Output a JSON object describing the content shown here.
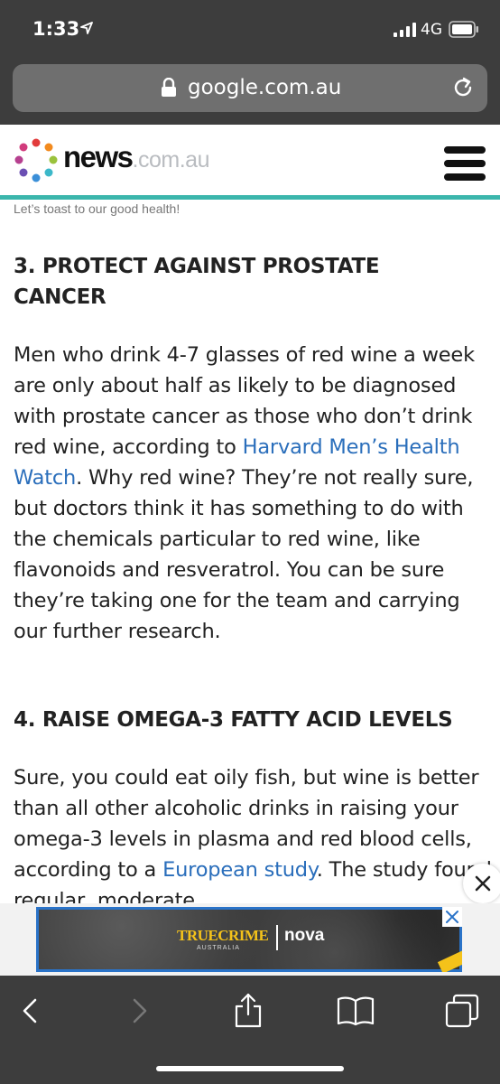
{
  "status_bar": {
    "time": "1:33",
    "network": "4G"
  },
  "browser": {
    "url": "google.com.au"
  },
  "site": {
    "logo_main": "news",
    "logo_suffix": ".com.au"
  },
  "article": {
    "caption": "Let’s toast to our good health!",
    "section1": {
      "heading_line1": "3. PROTECT AGAINST PROSTATE",
      "heading_line2": "CANCER",
      "p_part1": "Men who drink 4-7 glasses of red wine a week are only about half as likely to be diagnosed with prostate cancer as those who don’t drink red wine, according to ",
      "p_link": "Harvard Men’s Health Watch",
      "p_part2": ". Why red wine? They’re not really sure, but doctors think it has something to do with the chemicals particular to red wine, like flavonoids and resveratrol. You can be sure they’re taking one for the team and carrying our further research."
    },
    "section2": {
      "heading": "4. RAISE OMEGA-3 FATTY ACID LEVELS",
      "p_part1": "Sure, you could eat oily fish, but wine is better than all other alcoholic drinks in raising your omega-3 levels in plasma and red blood cells, according to a ",
      "p_link": "European study",
      "p_part2": ". The study found regular, moderate"
    }
  },
  "ad": {
    "brand": "TRUECRIME",
    "brand_sub": "AUSTRALIA",
    "partner": "nova"
  },
  "colors": {
    "chrome": "#3d3d3d",
    "accent_teal": "#3bb6ac",
    "link": "#2a6ebb"
  }
}
